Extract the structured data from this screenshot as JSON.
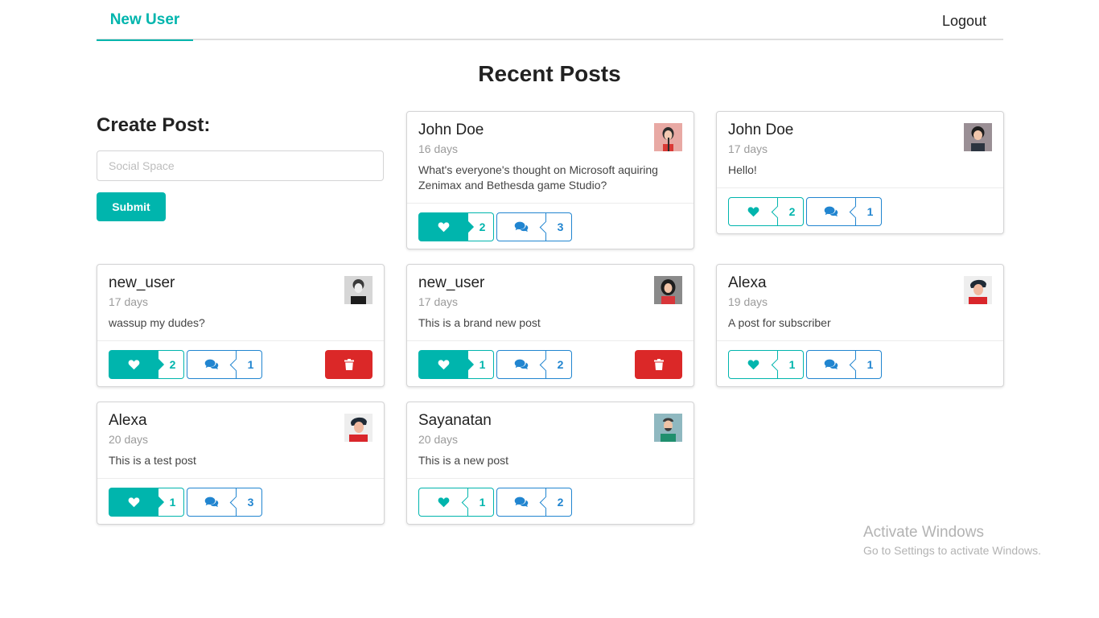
{
  "nav": {
    "new_user": "New User",
    "logout": "Logout"
  },
  "page": {
    "title": "Recent Posts"
  },
  "create_post": {
    "title": "Create Post:",
    "placeholder": "Social Space",
    "submit": "Submit"
  },
  "colors": {
    "accent": "#00b5ad",
    "blue": "#2185d0",
    "danger": "#db2828"
  },
  "posts": [
    {
      "author": "John Doe",
      "time": "16 days",
      "body": "What's everyone's thought on Microsoft aquiring Zenimax and Bethesda game Studio?",
      "likes": "2",
      "comments": "3",
      "liked": true,
      "deletable": false
    },
    {
      "author": "John Doe",
      "time": "17 days",
      "body": "Hello!",
      "likes": "2",
      "comments": "1",
      "liked": false,
      "deletable": false
    },
    {
      "author": "new_user",
      "time": "17 days",
      "body": "wassup my dudes?",
      "likes": "2",
      "comments": "1",
      "liked": true,
      "deletable": true
    },
    {
      "author": "new_user",
      "time": "17 days",
      "body": "This is a brand new post",
      "likes": "1",
      "comments": "2",
      "liked": true,
      "deletable": true
    },
    {
      "author": "Alexa",
      "time": "19 days",
      "body": "A post for subscriber",
      "likes": "1",
      "comments": "1",
      "liked": false,
      "deletable": false
    },
    {
      "author": "Alexa",
      "time": "20 days",
      "body": "This is a test post",
      "likes": "1",
      "comments": "3",
      "liked": true,
      "deletable": false
    },
    {
      "author": "Sayanatan",
      "time": "20 days",
      "body": "This is a new post",
      "likes": "1",
      "comments": "2",
      "liked": false,
      "deletable": false
    }
  ],
  "icons": {
    "like": "heart-icon",
    "comment": "comments-icon",
    "delete": "trash-icon"
  },
  "watermark": {
    "title": "Activate Windows",
    "subtitle": "Go to Settings to activate Windows."
  }
}
